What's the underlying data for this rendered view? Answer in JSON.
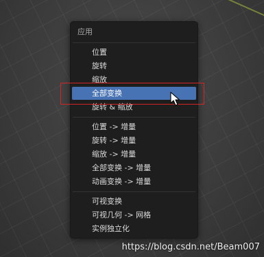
{
  "menu": {
    "title": "应用",
    "groups": [
      [
        "位置",
        "旋转",
        "缩放",
        "全部变换",
        "旋转 & 缩放"
      ],
      [
        "位置 -> 增量",
        "旋转 -> 增量",
        "缩放 -> 增量",
        "全部变换 -> 增量",
        "动画变换 -> 增量"
      ],
      [
        "可视变换",
        "可视几何 -> 网格",
        "实例独立化"
      ]
    ],
    "active_item": "全部变换"
  },
  "colors": {
    "menu_bg": "#1e1e1e",
    "active_bg": "#4772b3",
    "annotation_box": "#d42525",
    "axis_line": "#7f8c3a"
  },
  "icons": {
    "cursor": "mouse-pointer-icon"
  },
  "watermark": "https://blog.csdn.net/Beam007"
}
